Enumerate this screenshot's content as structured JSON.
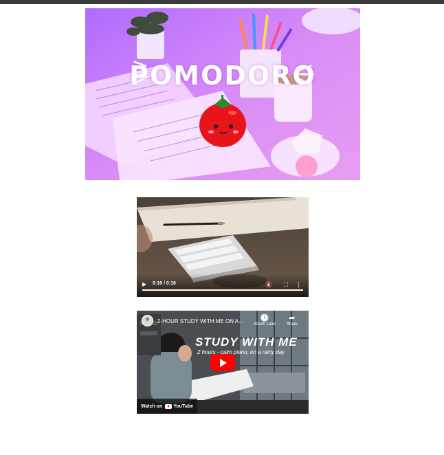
{
  "hero": {
    "title": "POMODORO"
  },
  "video_player": {
    "time": "0:16 / 0:16",
    "progress": 1.0,
    "icons": {
      "play": "play-icon",
      "volume": "volume-muted-icon",
      "fullscreen": "fullscreen-icon",
      "more": "more-vert-icon"
    }
  },
  "youtube": {
    "video_title": "2-HOUR STUDY WITH ME ON A...",
    "watch_later": "Watch Later",
    "share": "Share",
    "thumb_heading": "STUDY WITH ME",
    "thumb_subheading": "2 hours - calm piano, on a rainy day",
    "watch_on": "Watch on",
    "youtube_brand": "YouTube",
    "colors": {
      "play_button": "#ff0000"
    }
  },
  "colors": {
    "topbar": "#3b3b3b",
    "hero_tint": "#c37bff"
  }
}
